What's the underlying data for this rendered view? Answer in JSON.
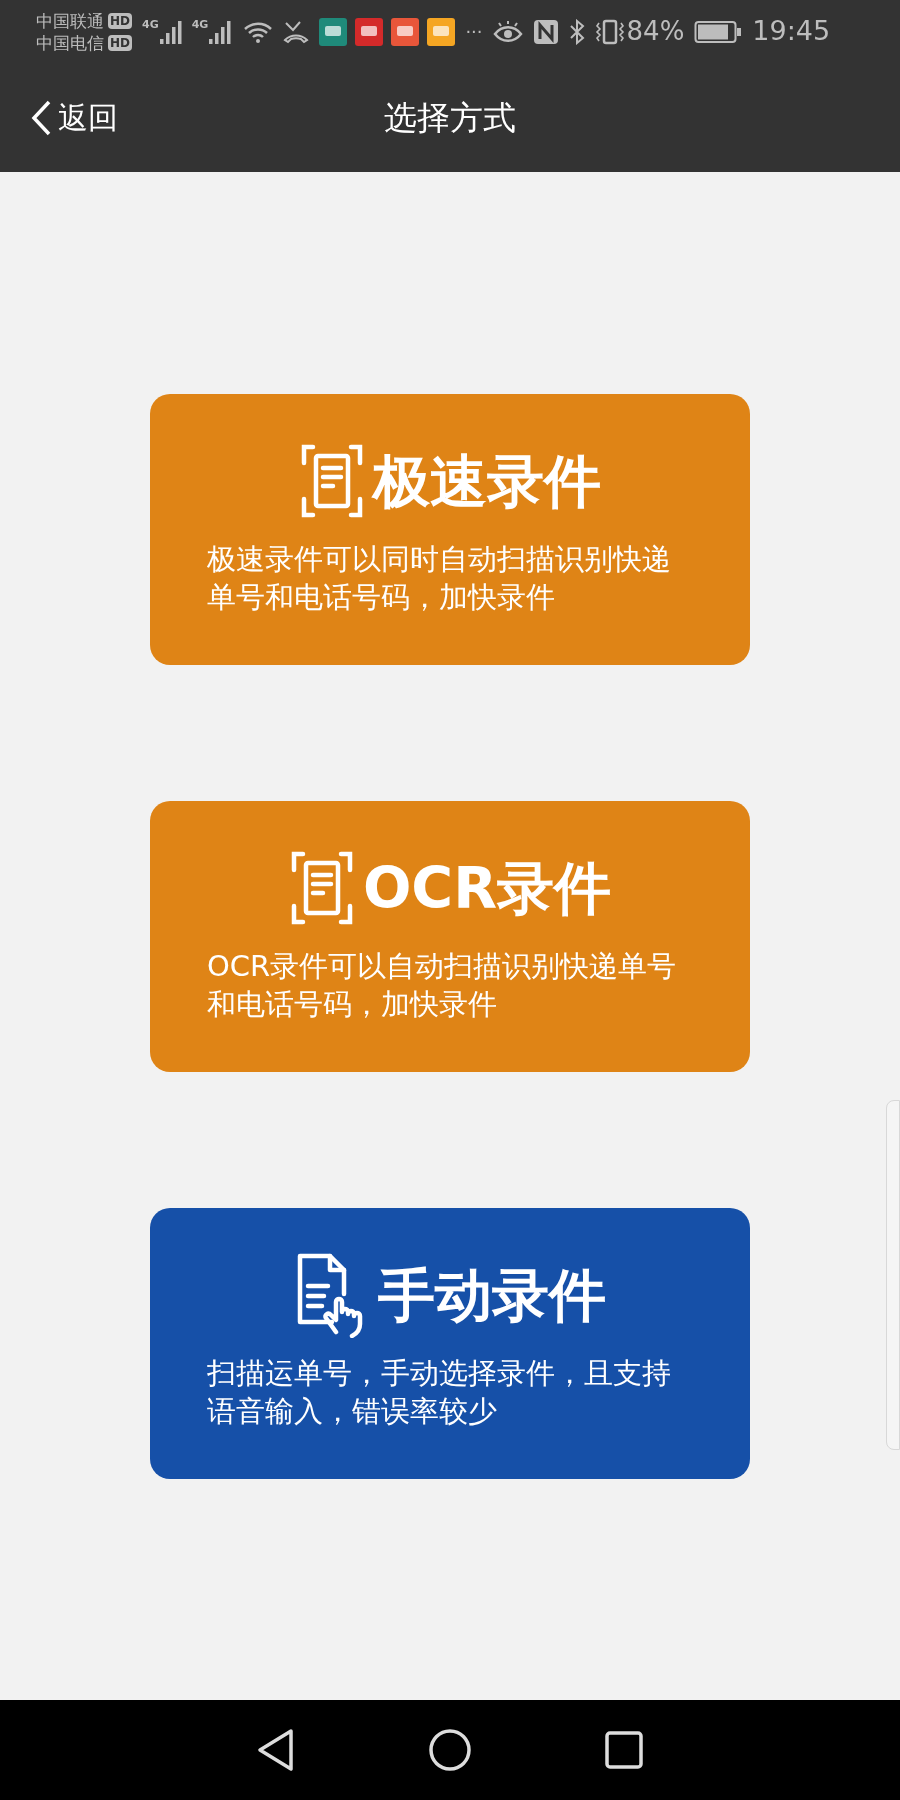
{
  "status_bar": {
    "carriers": [
      {
        "name": "中国联通",
        "badge": "HD"
      },
      {
        "name": "中国电信",
        "badge": "HD"
      }
    ],
    "signals": [
      {
        "label": "4G"
      },
      {
        "label": "4G"
      }
    ],
    "apps": [
      {
        "color": "#1f8a7a"
      },
      {
        "color": "#d42a2a"
      },
      {
        "color": "#e8563a"
      },
      {
        "color": "#f5a623"
      }
    ],
    "more": "···",
    "battery": "84%",
    "time": "19:45"
  },
  "nav_bar": {
    "back": "返回",
    "title": "选择方式"
  },
  "options": [
    {
      "kind": "scan",
      "color": "#df8416",
      "title": "极速录件",
      "description": "极速录件可以同时自动扫描识别快递单号和电话号码，加快录件"
    },
    {
      "kind": "scan",
      "color": "#df8416",
      "title": "OCR录件",
      "description": "OCR录件可以自动扫描识别快递单号和电话号码，加快录件"
    },
    {
      "kind": "manual",
      "color": "#1650a8",
      "title": "手动录件",
      "description": "扫描运单号，手动选择录件，且支持语音输入，错误率较少"
    }
  ]
}
